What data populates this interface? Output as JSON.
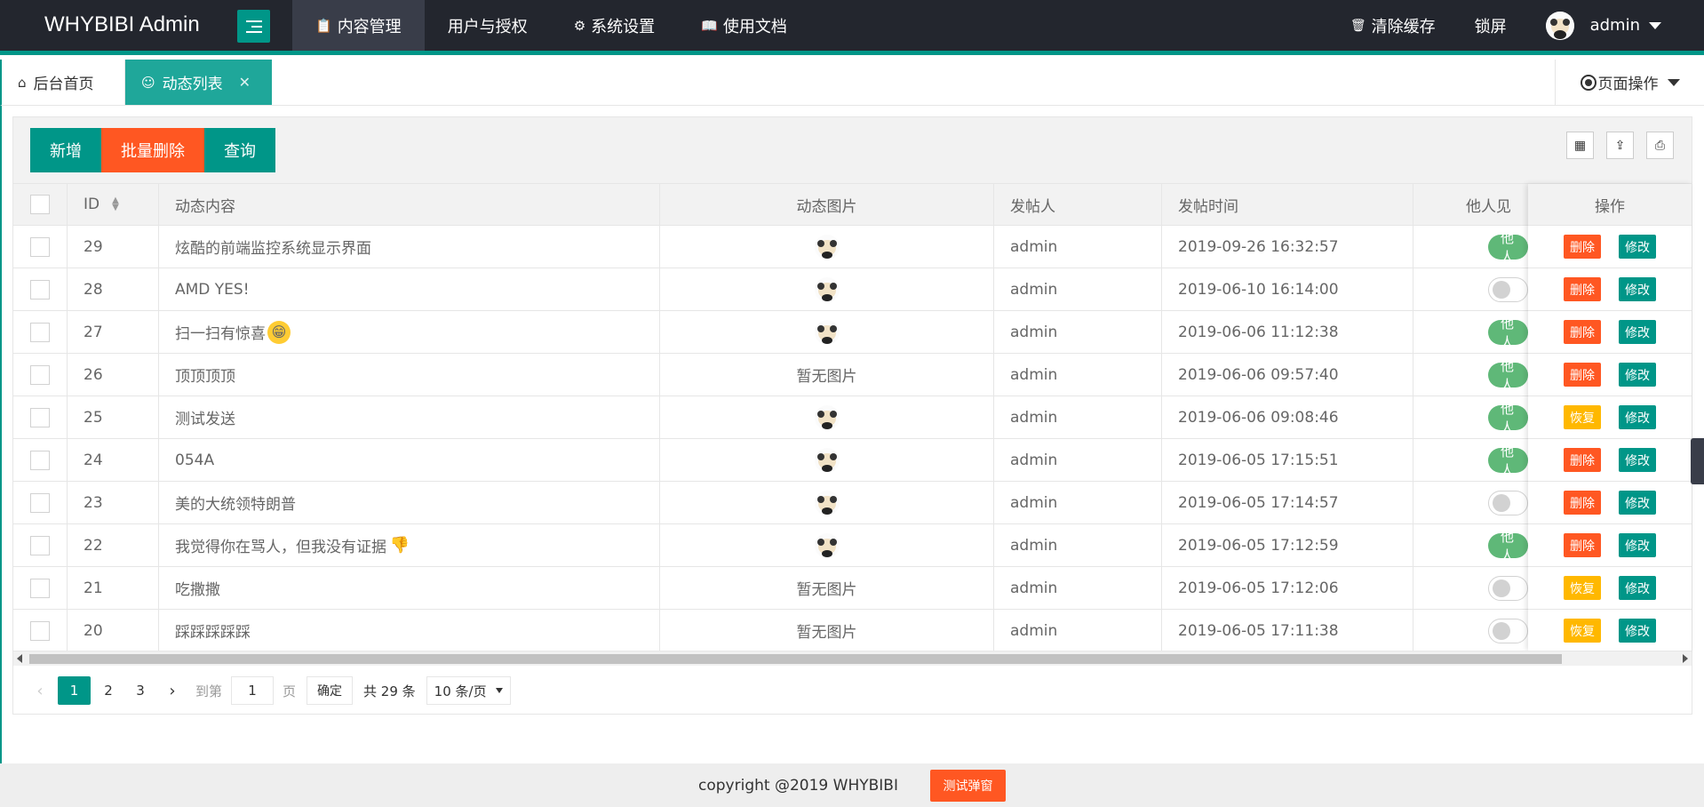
{
  "header": {
    "logo": "WHYBIBI Admin",
    "nav": [
      {
        "label": "内容管理",
        "icon": "clipboard-icon",
        "active": true
      },
      {
        "label": "用户与授权",
        "icon": "",
        "active": false
      },
      {
        "label": "系统设置",
        "icon": "gear-icon",
        "active": false
      },
      {
        "label": "使用文档",
        "icon": "book-icon",
        "active": false
      }
    ],
    "clear_cache": "清除缓存",
    "lock": "锁屏",
    "user": "admin"
  },
  "tabs": {
    "home": "后台首页",
    "current": "动态列表",
    "page_ops": "页面操作"
  },
  "toolbar": {
    "add": "新增",
    "batch_delete": "批量删除",
    "query": "查询"
  },
  "table": {
    "columns": [
      "ID",
      "动态内容",
      "动态图片",
      "发帖人",
      "发帖时间",
      "他人见",
      "操作"
    ],
    "switch_on_label": "他人",
    "switch_off_label": "",
    "no_image": "暂无图片",
    "delete_label": "删除",
    "edit_label": "修改",
    "restore_label": "恢复",
    "rows": [
      {
        "id": "29",
        "content": "炫酷的前端监控系统显示界面",
        "emoji": "",
        "has_image": true,
        "poster": "admin",
        "time": "2019-09-26 16:32:57",
        "visible": true,
        "action": "删除"
      },
      {
        "id": "28",
        "content": "AMD YES!",
        "emoji": "",
        "has_image": true,
        "poster": "admin",
        "time": "2019-06-10 16:14:00",
        "visible": false,
        "action": "删除"
      },
      {
        "id": "27",
        "content": "扫一扫有惊喜",
        "emoji": "grin-emoji",
        "has_image": true,
        "poster": "admin",
        "time": "2019-06-06 11:12:38",
        "visible": true,
        "action": "删除"
      },
      {
        "id": "26",
        "content": "顶顶顶顶",
        "emoji": "",
        "has_image": false,
        "poster": "admin",
        "time": "2019-06-06 09:57:40",
        "visible": true,
        "action": "删除"
      },
      {
        "id": "25",
        "content": "测试发送",
        "emoji": "",
        "has_image": true,
        "poster": "admin",
        "time": "2019-06-06 09:08:46",
        "visible": true,
        "action": "恢复"
      },
      {
        "id": "24",
        "content": "054A",
        "emoji": "",
        "has_image": true,
        "poster": "admin",
        "time": "2019-06-05 17:15:51",
        "visible": true,
        "action": "删除"
      },
      {
        "id": "23",
        "content": "美的大统领特朗普",
        "emoji": "",
        "has_image": true,
        "poster": "admin",
        "time": "2019-06-05 17:14:57",
        "visible": false,
        "action": "删除"
      },
      {
        "id": "22",
        "content": "我觉得你在骂人，但我没有证据",
        "emoji": "thumbs-down-emoji",
        "has_image": true,
        "poster": "admin",
        "time": "2019-06-05 17:12:59",
        "visible": true,
        "action": "删除"
      },
      {
        "id": "21",
        "content": "吃撒撒",
        "emoji": "",
        "has_image": false,
        "poster": "admin",
        "time": "2019-06-05 17:12:06",
        "visible": false,
        "action": "恢复"
      },
      {
        "id": "20",
        "content": "踩踩踩踩踩",
        "emoji": "",
        "has_image": false,
        "poster": "admin",
        "time": "2019-06-05 17:11:38",
        "visible": false,
        "action": "恢复"
      }
    ]
  },
  "pagination": {
    "pages": [
      "1",
      "2",
      "3"
    ],
    "current": "1",
    "goto_label": "到第",
    "goto_value": "1",
    "page_unit": "页",
    "confirm": "确定",
    "total": "共 29 条",
    "per_page": "10 条/页"
  },
  "footer": {
    "copyright": "copyright @2019 WHYBIBI",
    "test_button": "测试弹窗"
  },
  "colors": {
    "primary": "#009688",
    "danger": "#ff5722",
    "warning": "#ffb800",
    "switch_on": "#5fb878",
    "header_bg": "#23262e"
  }
}
